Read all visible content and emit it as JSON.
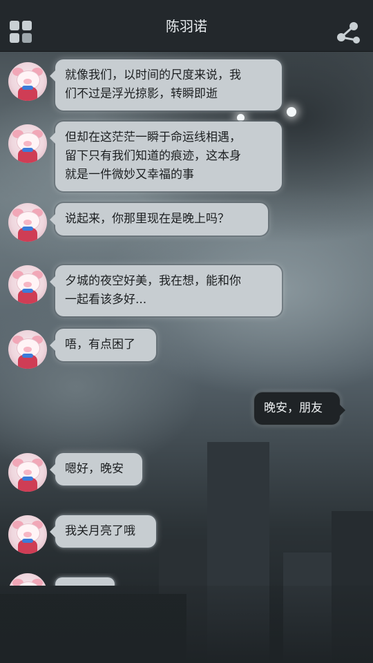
{
  "header": {
    "title": "陈羽诺",
    "grid_icon": "grid-icon",
    "share_icon": "share-icon"
  },
  "messages": [
    {
      "side": "left",
      "text_lines": [
        "就像我们，以时间的尺度来说，我",
        "们不过是浮光掠影，转瞬即逝"
      ]
    },
    {
      "side": "left",
      "text_lines": [
        "但却在这茫茫一瞬于命运线相遇，",
        "留下只有我们知道的痕迹，这本身",
        "就是一件微妙又幸福的事"
      ]
    },
    {
      "side": "left",
      "text_lines": [
        "说起来，你那里现在是晚上吗？"
      ]
    },
    {
      "side": "left",
      "text_lines": [
        "夕城的夜空好美，我在想，能和你",
        "一起看该多好..."
      ]
    },
    {
      "side": "left",
      "text_lines": [
        "唔，有点困了"
      ]
    },
    {
      "side": "right",
      "text_lines": [
        "晚安，朋友"
      ]
    },
    {
      "side": "left",
      "text_lines": [
        "嗯好，晚安"
      ]
    },
    {
      "side": "left",
      "text_lines": [
        "我关月亮了哦"
      ]
    }
  ],
  "colors": {
    "topbar": "#23282c",
    "bubble_left": "#c7cdd1",
    "bubble_right": "#1f2326"
  }
}
